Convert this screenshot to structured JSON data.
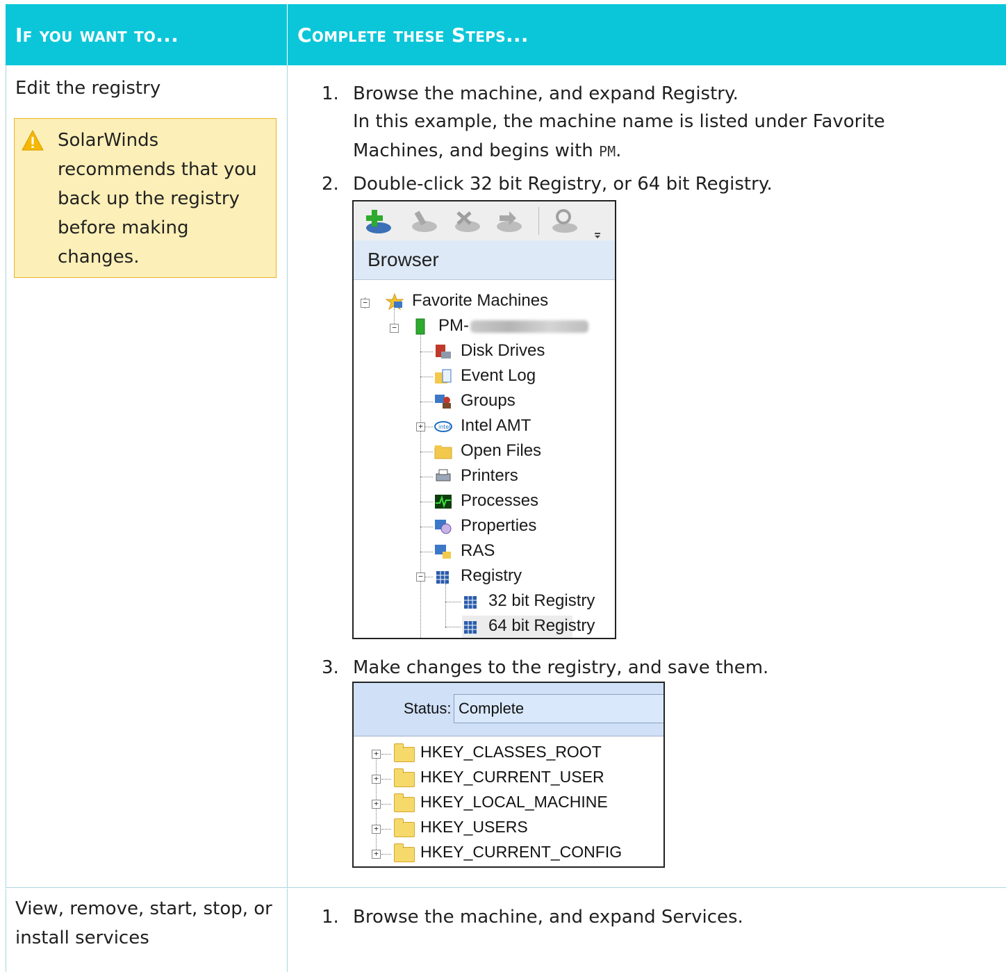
{
  "header": {
    "col1": "If you want to...",
    "col2": "Complete these Steps..."
  },
  "row1": {
    "task": "Edit the registry",
    "warning": "SolarWinds recommends that you back up the registry before making changes.",
    "steps": [
      {
        "num": "1.",
        "line1": "Browse the machine, and expand Registry.",
        "line2": "In this example, the machine name is listed under Favorite",
        "line3_pre": "Machines, and begins with ",
        "line3_code": "PM",
        "line3_post": "."
      },
      {
        "num": "2.",
        "text": "Double-click 32 bit Registry, or 64 bit Registry."
      },
      {
        "num": "3.",
        "text": "Make changes to the registry, and save them."
      }
    ],
    "browser": {
      "title": "Browser",
      "root": "Favorite Machines",
      "machine": "PM-",
      "items": [
        "Disk Drives",
        "Event Log",
        "Groups",
        "Intel AMT",
        "Open Files",
        "Printers",
        "Processes",
        "Properties",
        "RAS",
        "Registry"
      ],
      "sub_items": [
        "32 bit Registry",
        "64 bit Registry"
      ]
    },
    "registry": {
      "status_label": "Status:",
      "status_value": "Complete",
      "keys": [
        "HKEY_CLASSES_ROOT",
        "HKEY_CURRENT_USER",
        "HKEY_LOCAL_MACHINE",
        "HKEY_USERS",
        "HKEY_CURRENT_CONFIG"
      ]
    }
  },
  "row2": {
    "task": "View, remove, start, stop, or install services",
    "steps": [
      {
        "num": "1.",
        "text": "Browse the machine, and expand Services."
      }
    ]
  },
  "colors": {
    "header_bg": "#0bc6d9",
    "warning_bg": "#fcefb7",
    "warning_border": "#e8b42c",
    "grid": "#a9d7de"
  }
}
